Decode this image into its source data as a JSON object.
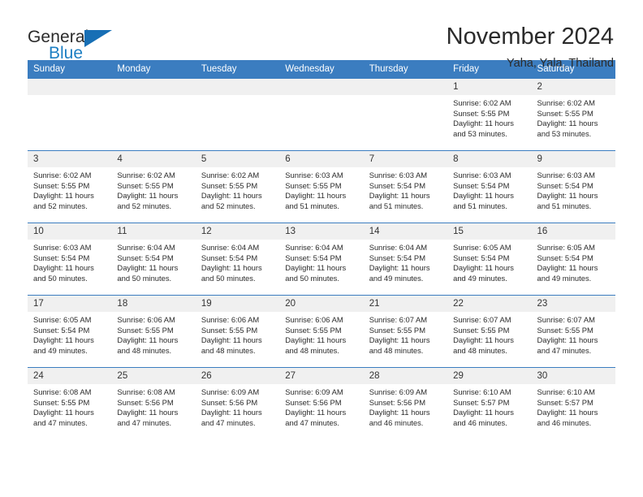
{
  "brand": {
    "name_part1": "General",
    "name_part2": "Blue",
    "accent_color": "#176fb5"
  },
  "header": {
    "month_title": "November 2024",
    "location": "Yaha, Yala, Thailand"
  },
  "calendar": {
    "header_color": "#3b7dc0",
    "weekday_headers": [
      "Sunday",
      "Monday",
      "Tuesday",
      "Wednesday",
      "Thursday",
      "Friday",
      "Saturday"
    ],
    "weeks": [
      [
        {
          "day": "",
          "empty": true
        },
        {
          "day": "",
          "empty": true
        },
        {
          "day": "",
          "empty": true
        },
        {
          "day": "",
          "empty": true
        },
        {
          "day": "",
          "empty": true
        },
        {
          "day": "1",
          "sunrise": "Sunrise: 6:02 AM",
          "sunset": "Sunset: 5:55 PM",
          "daylight": "Daylight: 11 hours and 53 minutes."
        },
        {
          "day": "2",
          "sunrise": "Sunrise: 6:02 AM",
          "sunset": "Sunset: 5:55 PM",
          "daylight": "Daylight: 11 hours and 53 minutes."
        }
      ],
      [
        {
          "day": "3",
          "sunrise": "Sunrise: 6:02 AM",
          "sunset": "Sunset: 5:55 PM",
          "daylight": "Daylight: 11 hours and 52 minutes."
        },
        {
          "day": "4",
          "sunrise": "Sunrise: 6:02 AM",
          "sunset": "Sunset: 5:55 PM",
          "daylight": "Daylight: 11 hours and 52 minutes."
        },
        {
          "day": "5",
          "sunrise": "Sunrise: 6:02 AM",
          "sunset": "Sunset: 5:55 PM",
          "daylight": "Daylight: 11 hours and 52 minutes."
        },
        {
          "day": "6",
          "sunrise": "Sunrise: 6:03 AM",
          "sunset": "Sunset: 5:55 PM",
          "daylight": "Daylight: 11 hours and 51 minutes."
        },
        {
          "day": "7",
          "sunrise": "Sunrise: 6:03 AM",
          "sunset": "Sunset: 5:54 PM",
          "daylight": "Daylight: 11 hours and 51 minutes."
        },
        {
          "day": "8",
          "sunrise": "Sunrise: 6:03 AM",
          "sunset": "Sunset: 5:54 PM",
          "daylight": "Daylight: 11 hours and 51 minutes."
        },
        {
          "day": "9",
          "sunrise": "Sunrise: 6:03 AM",
          "sunset": "Sunset: 5:54 PM",
          "daylight": "Daylight: 11 hours and 51 minutes."
        }
      ],
      [
        {
          "day": "10",
          "sunrise": "Sunrise: 6:03 AM",
          "sunset": "Sunset: 5:54 PM",
          "daylight": "Daylight: 11 hours and 50 minutes."
        },
        {
          "day": "11",
          "sunrise": "Sunrise: 6:04 AM",
          "sunset": "Sunset: 5:54 PM",
          "daylight": "Daylight: 11 hours and 50 minutes."
        },
        {
          "day": "12",
          "sunrise": "Sunrise: 6:04 AM",
          "sunset": "Sunset: 5:54 PM",
          "daylight": "Daylight: 11 hours and 50 minutes."
        },
        {
          "day": "13",
          "sunrise": "Sunrise: 6:04 AM",
          "sunset": "Sunset: 5:54 PM",
          "daylight": "Daylight: 11 hours and 50 minutes."
        },
        {
          "day": "14",
          "sunrise": "Sunrise: 6:04 AM",
          "sunset": "Sunset: 5:54 PM",
          "daylight": "Daylight: 11 hours and 49 minutes."
        },
        {
          "day": "15",
          "sunrise": "Sunrise: 6:05 AM",
          "sunset": "Sunset: 5:54 PM",
          "daylight": "Daylight: 11 hours and 49 minutes."
        },
        {
          "day": "16",
          "sunrise": "Sunrise: 6:05 AM",
          "sunset": "Sunset: 5:54 PM",
          "daylight": "Daylight: 11 hours and 49 minutes."
        }
      ],
      [
        {
          "day": "17",
          "sunrise": "Sunrise: 6:05 AM",
          "sunset": "Sunset: 5:54 PM",
          "daylight": "Daylight: 11 hours and 49 minutes."
        },
        {
          "day": "18",
          "sunrise": "Sunrise: 6:06 AM",
          "sunset": "Sunset: 5:55 PM",
          "daylight": "Daylight: 11 hours and 48 minutes."
        },
        {
          "day": "19",
          "sunrise": "Sunrise: 6:06 AM",
          "sunset": "Sunset: 5:55 PM",
          "daylight": "Daylight: 11 hours and 48 minutes."
        },
        {
          "day": "20",
          "sunrise": "Sunrise: 6:06 AM",
          "sunset": "Sunset: 5:55 PM",
          "daylight": "Daylight: 11 hours and 48 minutes."
        },
        {
          "day": "21",
          "sunrise": "Sunrise: 6:07 AM",
          "sunset": "Sunset: 5:55 PM",
          "daylight": "Daylight: 11 hours and 48 minutes."
        },
        {
          "day": "22",
          "sunrise": "Sunrise: 6:07 AM",
          "sunset": "Sunset: 5:55 PM",
          "daylight": "Daylight: 11 hours and 48 minutes."
        },
        {
          "day": "23",
          "sunrise": "Sunrise: 6:07 AM",
          "sunset": "Sunset: 5:55 PM",
          "daylight": "Daylight: 11 hours and 47 minutes."
        }
      ],
      [
        {
          "day": "24",
          "sunrise": "Sunrise: 6:08 AM",
          "sunset": "Sunset: 5:55 PM",
          "daylight": "Daylight: 11 hours and 47 minutes."
        },
        {
          "day": "25",
          "sunrise": "Sunrise: 6:08 AM",
          "sunset": "Sunset: 5:56 PM",
          "daylight": "Daylight: 11 hours and 47 minutes."
        },
        {
          "day": "26",
          "sunrise": "Sunrise: 6:09 AM",
          "sunset": "Sunset: 5:56 PM",
          "daylight": "Daylight: 11 hours and 47 minutes."
        },
        {
          "day": "27",
          "sunrise": "Sunrise: 6:09 AM",
          "sunset": "Sunset: 5:56 PM",
          "daylight": "Daylight: 11 hours and 47 minutes."
        },
        {
          "day": "28",
          "sunrise": "Sunrise: 6:09 AM",
          "sunset": "Sunset: 5:56 PM",
          "daylight": "Daylight: 11 hours and 46 minutes."
        },
        {
          "day": "29",
          "sunrise": "Sunrise: 6:10 AM",
          "sunset": "Sunset: 5:57 PM",
          "daylight": "Daylight: 11 hours and 46 minutes."
        },
        {
          "day": "30",
          "sunrise": "Sunrise: 6:10 AM",
          "sunset": "Sunset: 5:57 PM",
          "daylight": "Daylight: 11 hours and 46 minutes."
        }
      ]
    ]
  }
}
